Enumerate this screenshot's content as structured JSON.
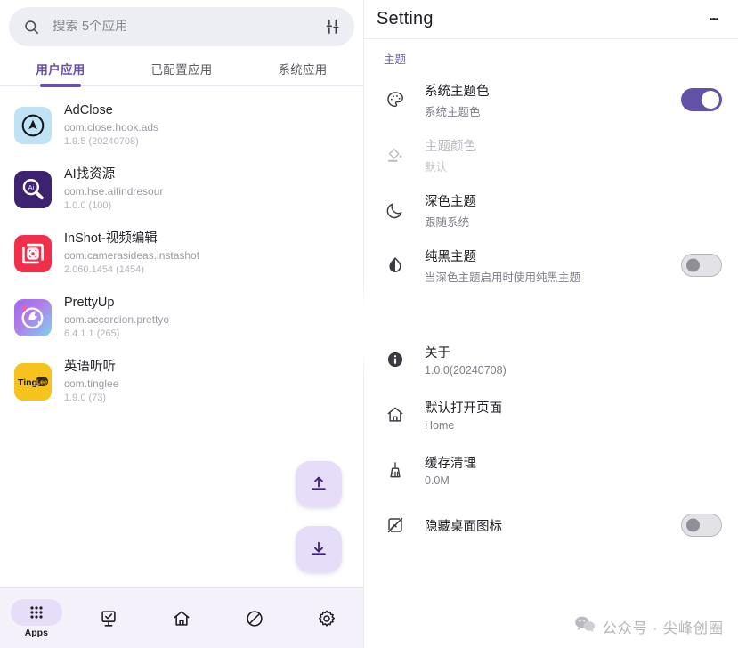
{
  "left": {
    "search": {
      "placeholder": "搜索 5个应用",
      "value": "",
      "search_icon": "search-icon",
      "filter_icon": "tune-icon"
    },
    "tabs": [
      {
        "label": "用户应用",
        "active": true
      },
      {
        "label": "已配置应用",
        "active": false
      },
      {
        "label": "系统应用",
        "active": false
      }
    ],
    "apps": [
      {
        "name": "AdClose",
        "package": "com.close.hook.ads",
        "version": "1.9.5 (20240708)",
        "icon": "adclose-icon"
      },
      {
        "name": "AI找资源",
        "package": "com.hse.aifindresour",
        "version": "1.0.0 (100)",
        "icon": "ai-search-icon"
      },
      {
        "name": "InShot-视频编辑",
        "package": "com.camerasideas.instashot",
        "version": "2.060.1454 (1454)",
        "icon": "inshot-icon"
      },
      {
        "name": "PrettyUp",
        "package": "com.accordion.prettyo",
        "version": "6.4.1.1 (265)",
        "icon": "prettyup-icon"
      },
      {
        "name": "英语听听",
        "package": "com.tinglee",
        "version": "1.9.0 (73)",
        "icon": "tinglee-icon"
      }
    ],
    "fabs": [
      {
        "name": "export-fab",
        "icon": "upload-icon"
      },
      {
        "name": "import-fab",
        "icon": "download-icon"
      }
    ],
    "bottom_nav": [
      {
        "label": "Apps",
        "icon": "apps-grid-icon",
        "active": true
      },
      {
        "label": "",
        "icon": "monitor-check-icon",
        "active": false
      },
      {
        "label": "",
        "icon": "home-icon",
        "active": false
      },
      {
        "label": "",
        "icon": "block-icon",
        "active": false
      },
      {
        "label": "",
        "icon": "gear-icon",
        "active": false
      }
    ]
  },
  "right": {
    "title": "Setting",
    "overflow_icon": "kebab-menu-icon",
    "section_theme": "主题",
    "rows": [
      {
        "title": "系统主题色",
        "subtitle": "系统主题色",
        "icon": "palette-icon",
        "control": "toggle",
        "state": "on",
        "disabled": false
      },
      {
        "title": "主题颜色",
        "subtitle": "默认",
        "icon": "format-paint-icon",
        "control": "none",
        "state": "",
        "disabled": true
      },
      {
        "title": "深色主题",
        "subtitle": "跟随系统",
        "icon": "moon-icon",
        "control": "none",
        "state": "",
        "disabled": false
      },
      {
        "title": "纯黑主题",
        "subtitle": "当深色主题启用时使用纯黑主题",
        "icon": "contrast-icon",
        "control": "toggle",
        "state": "off",
        "disabled": false
      },
      {
        "title": "关于",
        "subtitle": "1.0.0(20240708)",
        "icon": "info-icon",
        "control": "none",
        "state": "",
        "disabled": false
      },
      {
        "title": "默认打开页面",
        "subtitle": "Home",
        "icon": "home-outline-icon",
        "control": "none",
        "state": "",
        "disabled": false
      },
      {
        "title": "缓存清理",
        "subtitle": "0.0M",
        "icon": "broom-icon",
        "control": "none",
        "state": "",
        "disabled": false
      },
      {
        "title": "隐藏桌面图标",
        "subtitle": "",
        "icon": "hide-image-icon",
        "control": "toggle",
        "state": "off",
        "disabled": false
      }
    ],
    "watermark": {
      "text": "公众号 · 尖峰创圈",
      "icon": "wechat-icon"
    }
  },
  "colors": {
    "accent": "#6b4fb0",
    "toggle_on": "#6152a8",
    "nav_bg": "#f5f1fa",
    "fab_bg": "#e6ddf8",
    "search_bg": "#eceef4"
  }
}
